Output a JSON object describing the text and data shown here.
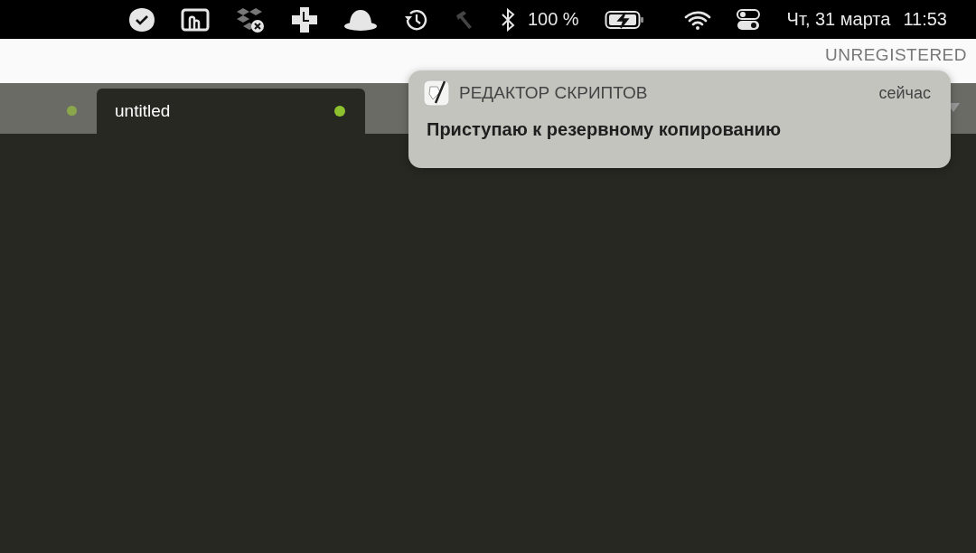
{
  "menu_bar": {
    "battery": "100 %",
    "date": "Чт, 31 марта",
    "time": "11:53"
  },
  "window": {
    "registration": "UNREGISTERED"
  },
  "tabs": [
    {
      "label": "untitled",
      "selected": true,
      "modified": true
    }
  ],
  "notification": {
    "app": "РЕДАКТОР СКРИПТОВ",
    "time": "сейчас",
    "message": "Приступаю к резервному копированию"
  }
}
